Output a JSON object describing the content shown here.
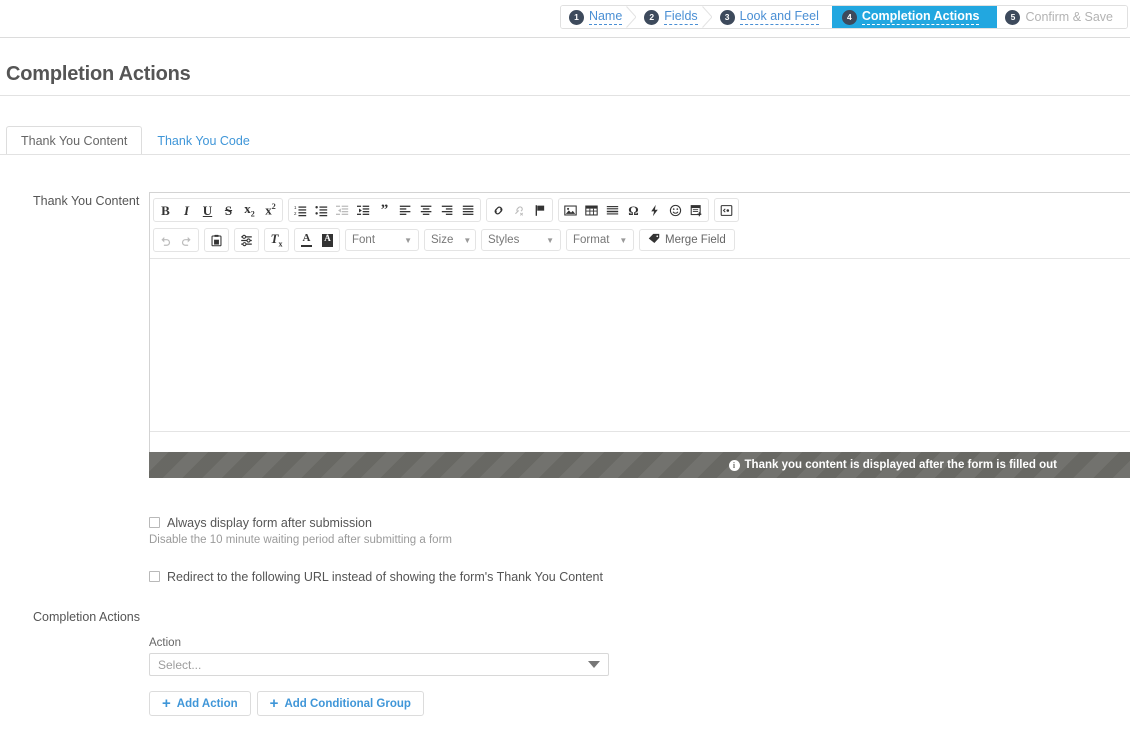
{
  "wizard": {
    "steps": [
      {
        "num": "1",
        "label": "Name",
        "state": "done"
      },
      {
        "num": "2",
        "label": "Fields",
        "state": "done"
      },
      {
        "num": "3",
        "label": "Look and Feel",
        "state": "done"
      },
      {
        "num": "4",
        "label": "Completion Actions",
        "state": "active"
      },
      {
        "num": "5",
        "label": "Confirm & Save",
        "state": "future"
      }
    ]
  },
  "page": {
    "title": "Completion Actions"
  },
  "tabs": [
    {
      "label": "Thank You Content",
      "active": true
    },
    {
      "label": "Thank You Code",
      "active": false
    }
  ],
  "editor": {
    "label": "Thank You Content",
    "content": "",
    "statusbar": {
      "icon": "info-icon",
      "text": "Thank you content is displayed after the form is filled out"
    },
    "toolbar": {
      "row1": [
        {
          "group": "text-style",
          "buttons": [
            {
              "name": "bold-icon",
              "glyph": "B",
              "disabled": false
            },
            {
              "name": "italic-icon",
              "glyph": "I",
              "disabled": false
            },
            {
              "name": "underline-icon",
              "glyph": "U",
              "disabled": false
            },
            {
              "name": "strikethrough-icon",
              "glyph": "S",
              "disabled": false
            },
            {
              "name": "subscript-icon",
              "glyph": "x₂",
              "disabled": false
            },
            {
              "name": "superscript-icon",
              "glyph": "x²",
              "disabled": false
            }
          ]
        },
        {
          "group": "paragraph",
          "buttons": [
            {
              "name": "numbered-list-icon",
              "disabled": false
            },
            {
              "name": "bulleted-list-icon",
              "disabled": false
            },
            {
              "name": "outdent-icon",
              "disabled": true
            },
            {
              "name": "indent-icon",
              "disabled": false
            },
            {
              "name": "blockquote-icon",
              "disabled": false
            },
            {
              "name": "align-left-icon",
              "disabled": false
            },
            {
              "name": "align-center-icon",
              "disabled": false
            },
            {
              "name": "align-right-icon",
              "disabled": false
            },
            {
              "name": "align-justify-icon",
              "disabled": false
            }
          ]
        },
        {
          "group": "links",
          "buttons": [
            {
              "name": "link-icon",
              "disabled": false
            },
            {
              "name": "unlink-icon",
              "disabled": true
            },
            {
              "name": "anchor-flag-icon",
              "disabled": false
            }
          ]
        },
        {
          "group": "insert",
          "buttons": [
            {
              "name": "image-icon",
              "disabled": false
            },
            {
              "name": "table-icon",
              "disabled": false
            },
            {
              "name": "horizontal-rule-icon",
              "disabled": false
            },
            {
              "name": "special-character-icon",
              "disabled": false
            },
            {
              "name": "page-break-icon",
              "disabled": false
            },
            {
              "name": "smiley-icon",
              "disabled": false
            },
            {
              "name": "templates-icon",
              "disabled": false
            }
          ]
        },
        {
          "group": "source",
          "buttons": [
            {
              "name": "source-code-icon",
              "disabled": false
            }
          ]
        }
      ],
      "row2": [
        {
          "group": "history",
          "buttons": [
            {
              "name": "undo-icon",
              "disabled": true
            },
            {
              "name": "redo-icon",
              "disabled": true
            }
          ]
        },
        {
          "group": "paste",
          "buttons": [
            {
              "name": "paste-icon",
              "disabled": false
            }
          ]
        },
        {
          "group": "paste-options",
          "buttons": [
            {
              "name": "paste-options-icon",
              "disabled": false
            }
          ]
        },
        {
          "group": "remove-format",
          "buttons": [
            {
              "name": "remove-format-icon",
              "disabled": false
            }
          ]
        },
        {
          "group": "colors",
          "buttons": [
            {
              "name": "text-color-icon",
              "disabled": false
            },
            {
              "name": "background-color-icon",
              "disabled": false
            }
          ]
        }
      ],
      "selects": [
        {
          "name": "font-select",
          "label": "Font"
        },
        {
          "name": "size-select",
          "label": "Size"
        },
        {
          "name": "styles-select",
          "label": "Styles"
        },
        {
          "name": "format-select",
          "label": "Format"
        }
      ],
      "merge_field": {
        "name": "merge-field-button",
        "label": "Merge Field",
        "icon": "tag-icon"
      }
    }
  },
  "options": {
    "always_display": {
      "label": "Always display form after submission",
      "help": "Disable the 10 minute waiting period after submitting a form",
      "checked": false
    },
    "redirect": {
      "label": "Redirect to the following URL instead of showing the form's Thank You Content",
      "checked": false
    }
  },
  "completion_actions": {
    "section_label": "Completion Actions",
    "action_label": "Action",
    "action_value": "Select...",
    "buttons": [
      {
        "name": "add-action-button",
        "label": "Add Action"
      },
      {
        "name": "add-conditional-group-button",
        "label": "Add Conditional Group"
      }
    ]
  },
  "colors": {
    "accent": "#22a7e0",
    "link": "#3f96d8",
    "badge": "#3d4a5c",
    "statusbar": "#6c6c67"
  }
}
